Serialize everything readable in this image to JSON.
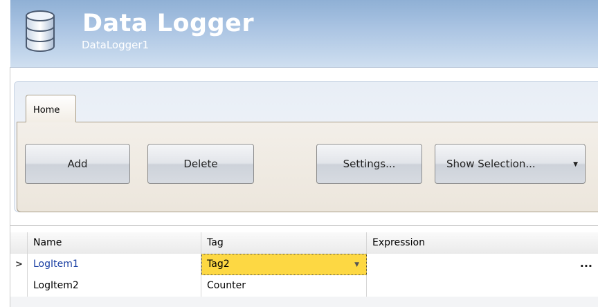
{
  "header": {
    "title": "Data Logger",
    "subtitle": "DataLogger1",
    "icon": "database-icon"
  },
  "ribbon": {
    "tabs": [
      {
        "label": "Home",
        "active": true
      }
    ],
    "buttons": {
      "add": "Add",
      "delete": "Delete",
      "settings": "Settings...",
      "show_selection": "Show Selection..."
    }
  },
  "grid": {
    "columns": [
      "Name",
      "Tag",
      "Expression"
    ],
    "rows": [
      {
        "name": "LogItem1",
        "tag": "Tag2",
        "expression": "",
        "current": true
      },
      {
        "name": "LogItem2",
        "tag": "Counter",
        "expression": "",
        "current": false
      }
    ],
    "ellipsis": "..."
  },
  "colors": {
    "header_gradient_top": "#8fb0d5",
    "header_gradient_bottom": "#cfdff0",
    "active_cell": "#fdd843",
    "link_text": "#1a3fa3"
  }
}
